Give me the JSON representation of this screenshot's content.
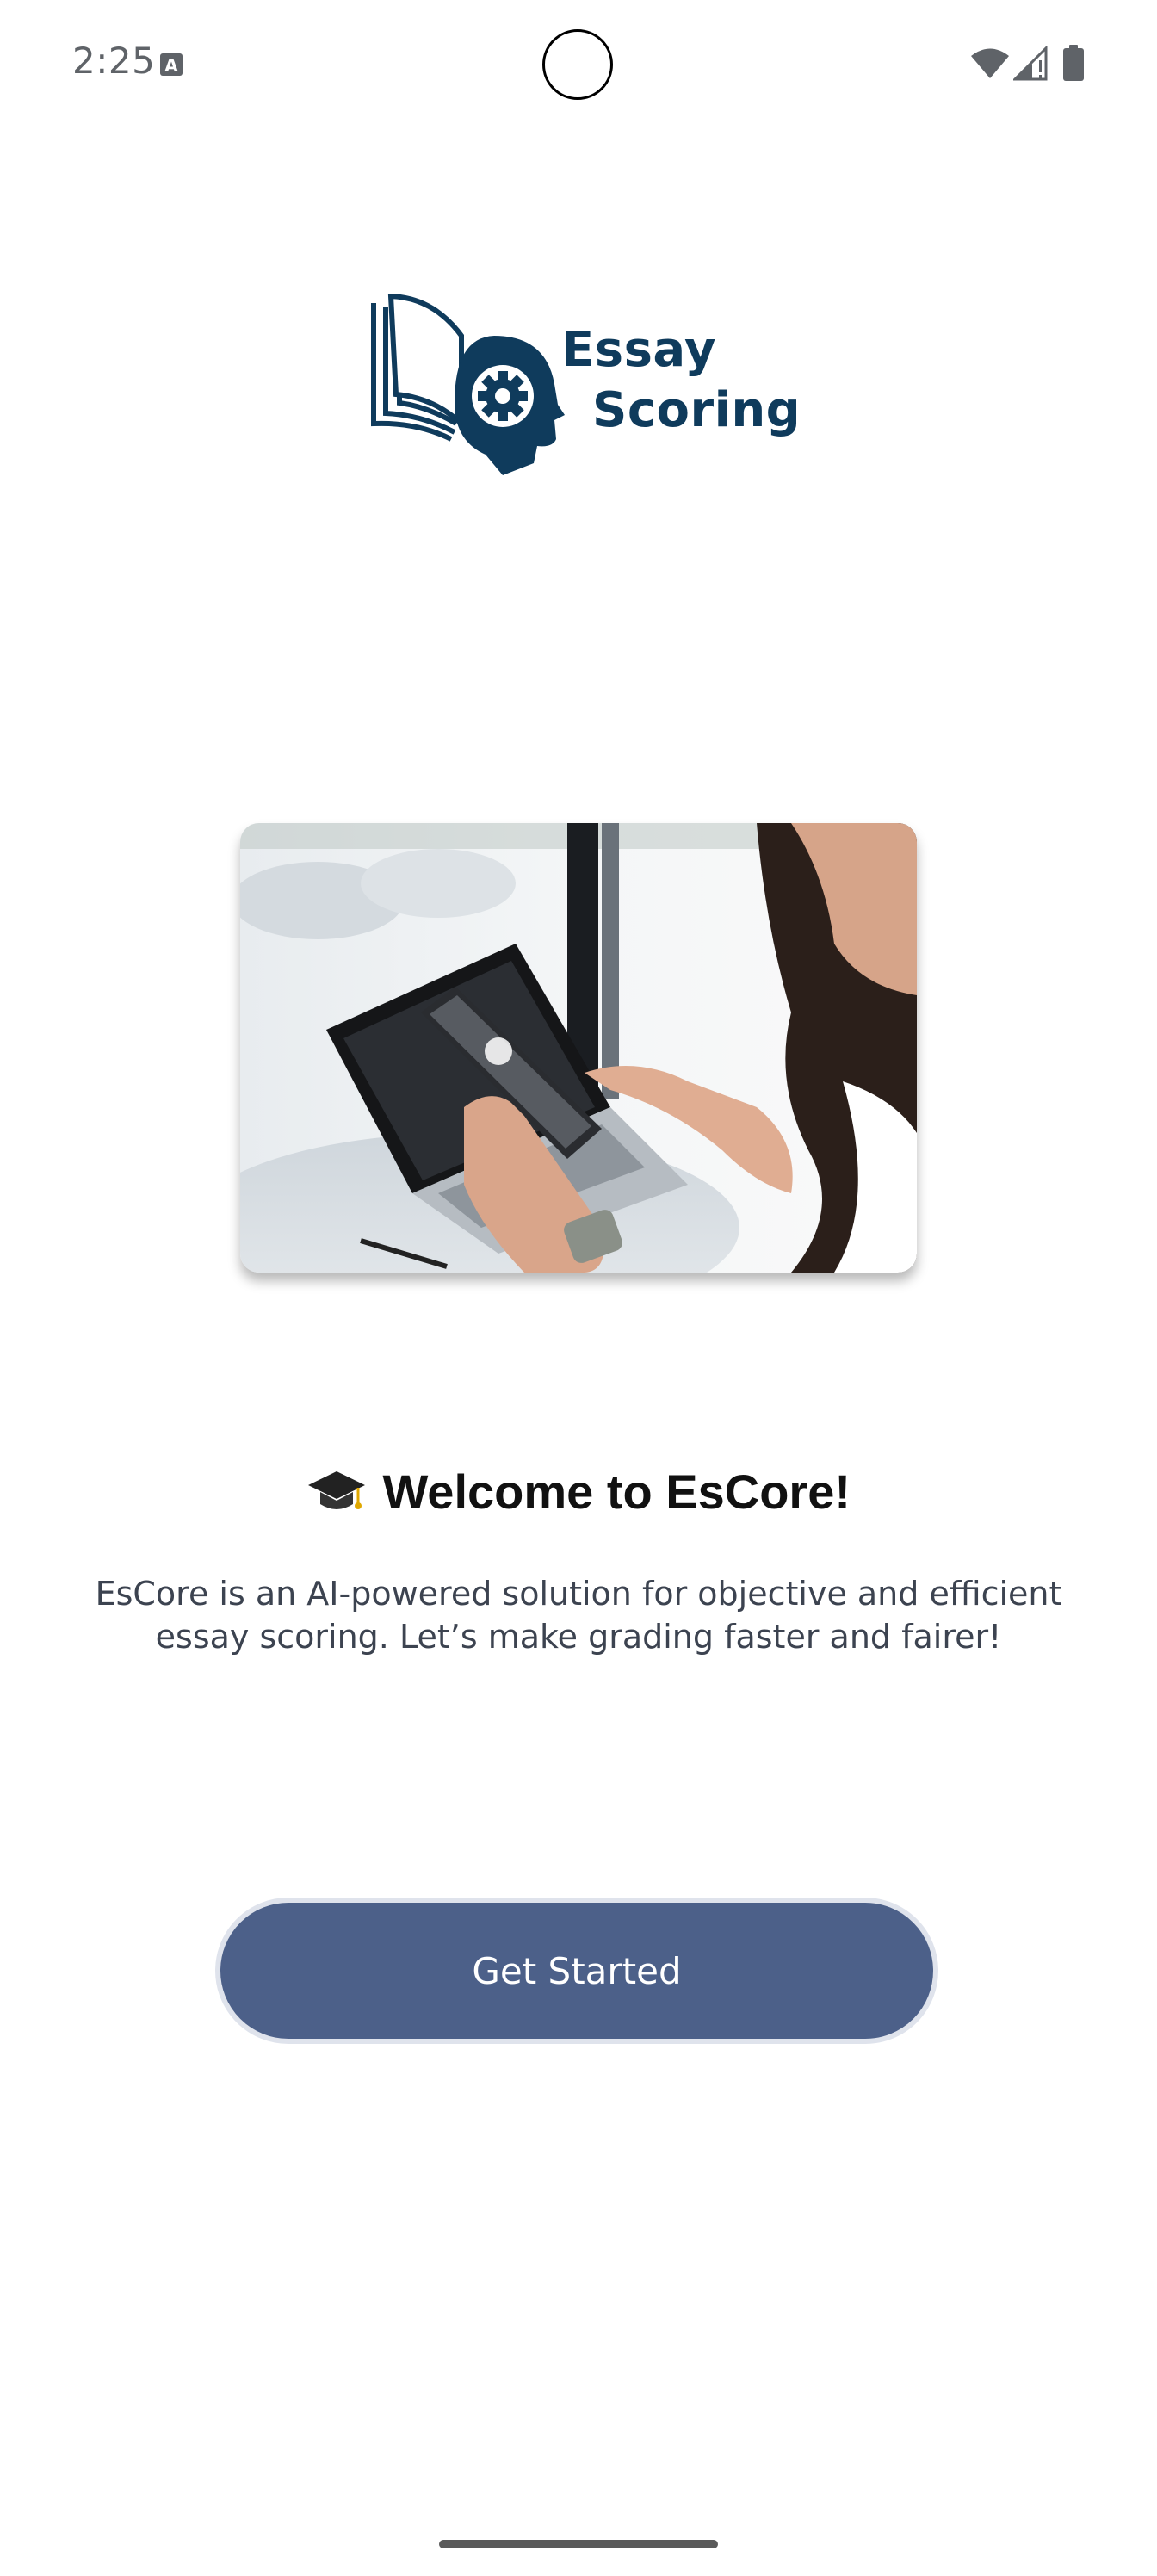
{
  "status_bar": {
    "time": "2:25",
    "icons": [
      "text-a-icon",
      "wifi-icon",
      "signal-icon",
      "battery-icon"
    ]
  },
  "logo": {
    "line1": "Essay",
    "line2": "Scoring",
    "color": "#0f3b5c"
  },
  "hero": {
    "icon": "person-using-phone-photo"
  },
  "welcome": {
    "emoji_icon": "graduation-cap-icon",
    "title": "Welcome to EsCore!",
    "description": "EsCore is an AI-powered solution for objective and efficient essay scoring. Let’s make grading faster and fairer!"
  },
  "button": {
    "label": "Get Started",
    "color": "#4c6089"
  }
}
